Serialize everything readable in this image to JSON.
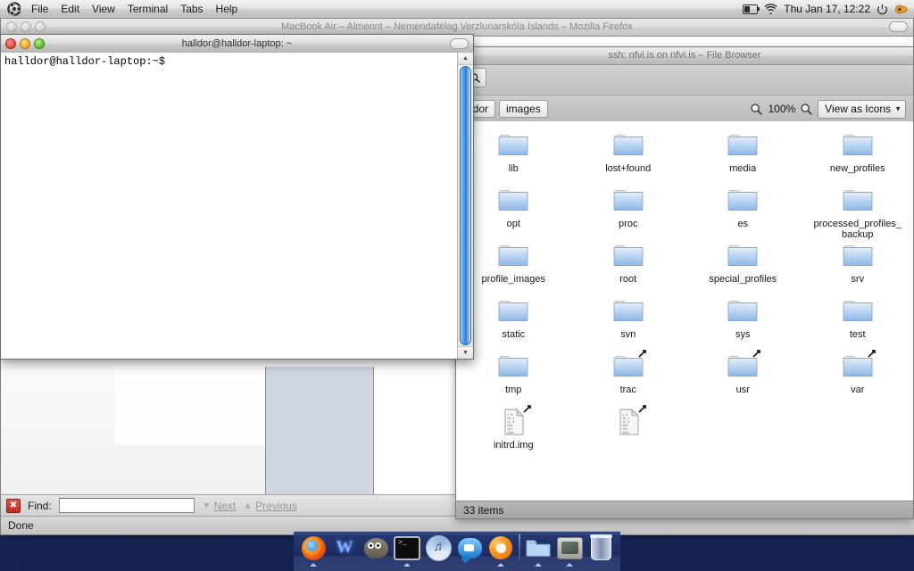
{
  "menubar": {
    "logo_icon": "ubuntu-logo-icon",
    "items": [
      "File",
      "Edit",
      "View",
      "Terminal",
      "Tabs",
      "Help"
    ],
    "status_icons": [
      "battery-icon",
      "wifi-icon"
    ],
    "clock": "Thu Jan 17, 12:22",
    "power_icon": "power-icon",
    "extra_icon": "orange-app-icon"
  },
  "firefox": {
    "title": "MacBook Air – Almennt – Nemendafélag Verzlunarskóla Íslands – Mozilla Firefox",
    "findbar": {
      "close_label": "✖",
      "label": "Find:",
      "value": "",
      "placeholder": "",
      "next_label": "Next",
      "prev_label": "Previous"
    },
    "status": "Done"
  },
  "filebrowser": {
    "title": "ssh: nfvi.is on nfvi.is – File Browser",
    "search_icon": "search-icon",
    "breadcrumbs": [
      "ldor",
      "images"
    ],
    "zoom_out_icon": "zoom-out-icon",
    "zoom_level": "100%",
    "zoom_in_icon": "zoom-in-icon",
    "view_mode": "View as Icons",
    "chevron_icon": "chevron-down-icon",
    "status": "33 items",
    "items": [
      {
        "name": "lib",
        "type": "folder",
        "symlink": false
      },
      {
        "name": "lost+found",
        "type": "folder",
        "symlink": false
      },
      {
        "name": "media",
        "type": "folder",
        "symlink": false
      },
      {
        "name": "new_profiles",
        "type": "folder",
        "symlink": false
      },
      {
        "name": "opt",
        "type": "folder",
        "symlink": false
      },
      {
        "name": "proc",
        "type": "folder",
        "symlink": false
      },
      {
        "name": "es",
        "type": "folder",
        "symlink": false
      },
      {
        "name": "processed_profiles_backup",
        "type": "folder",
        "symlink": false
      },
      {
        "name": "profile_images",
        "type": "folder",
        "symlink": false
      },
      {
        "name": "root",
        "type": "folder",
        "symlink": false
      },
      {
        "name": "special_profiles",
        "type": "folder",
        "symlink": false
      },
      {
        "name": "srv",
        "type": "folder",
        "symlink": false
      },
      {
        "name": "static",
        "type": "folder",
        "symlink": false
      },
      {
        "name": "svn",
        "type": "folder",
        "symlink": false
      },
      {
        "name": "sys",
        "type": "folder",
        "symlink": false
      },
      {
        "name": "test",
        "type": "folder",
        "symlink": false
      },
      {
        "name": "tmp",
        "type": "folder",
        "symlink": false
      },
      {
        "name": "trac",
        "type": "folder",
        "symlink": true
      },
      {
        "name": "usr",
        "type": "folder",
        "symlink": true
      },
      {
        "name": "var",
        "type": "folder",
        "symlink": true
      },
      {
        "name": "initrd.img",
        "type": "file",
        "symlink": true
      },
      {
        "name": "",
        "type": "file",
        "symlink": true
      }
    ]
  },
  "terminal": {
    "title": "halldor@halldor-laptop: ~",
    "content": "halldor@halldor-laptop:~$",
    "scroll_up_icon": "scroll-up-icon",
    "scroll_down_icon": "scroll-down-icon"
  },
  "dock": {
    "items": [
      {
        "name": "firefox",
        "icon": "firefox-icon",
        "running": true
      },
      {
        "name": "wine",
        "icon": "wine-icon",
        "running": false
      },
      {
        "name": "gimp",
        "icon": "gimp-icon",
        "running": false
      },
      {
        "name": "terminal",
        "icon": "terminal-icon",
        "running": true
      },
      {
        "name": "media-player",
        "icon": "media-player-icon",
        "running": false
      },
      {
        "name": "chat",
        "icon": "chat-icon",
        "running": false
      },
      {
        "name": "pidgin",
        "icon": "pidgin-icon",
        "running": true
      },
      {
        "name": "file-manager",
        "icon": "folder-icon",
        "running": true
      },
      {
        "name": "console",
        "icon": "monitor-icon",
        "running": true
      },
      {
        "name": "trash",
        "icon": "trash-icon",
        "running": false
      }
    ]
  },
  "colors": {
    "desktop": "#1b2f70",
    "dock": "#1c2c60",
    "folder": "#9dc2ee",
    "accent_blue": "#2e7fd6"
  }
}
